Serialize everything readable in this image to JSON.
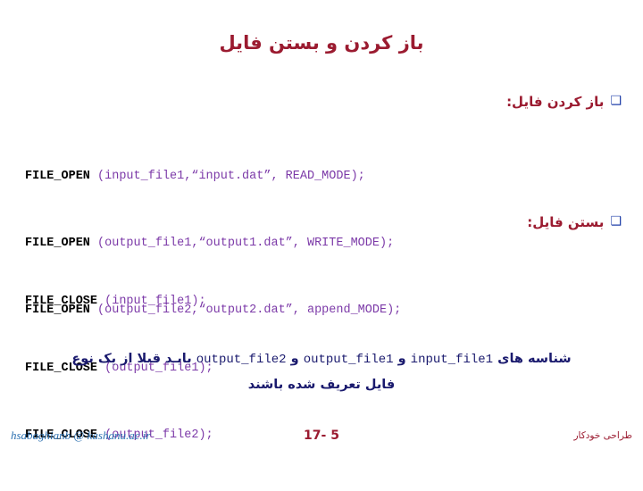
{
  "slide": {
    "title": "باز کردن و بستن فایل",
    "sections": [
      {
        "heading": "باز کردن فایل:",
        "marker": "❑",
        "lines": [
          {
            "fn": "FILE_OPEN",
            "args": "(input_file1,“input.dat”, READ_MODE);"
          },
          {
            "fn": "FILE_OPEN",
            "args": "(output_file1,“output1.dat”, WRITE_MODE);"
          },
          {
            "fn": "FILE_OPEN",
            "args": "(output_file2,“output2.dat”, append_MODE);"
          }
        ]
      },
      {
        "heading": "بستن فایل:",
        "marker": "❑",
        "lines": [
          {
            "fn": "FILE_CLOSE",
            "args": "(input_file1);"
          },
          {
            "fn": "FILE_CLOSE",
            "args": "(output_file1);"
          },
          {
            "fn": "FILE_CLOSE",
            "args": "(output_file2);"
          }
        ]
      }
    ],
    "note": {
      "line1_a": "شناسه های",
      "id1": "input_file1",
      "conj1": "و",
      "id2": "output_file1",
      "conj2": "و",
      "id3": "output_file2",
      "line1_b": "بایـد قبلا از یک نوع",
      "line2": "فایل تعریف شده باشند"
    },
    "footer": {
      "email": "hsabaghianb @ kashanu.ac.ir",
      "page": "17- 5",
      "right": "طراحی خودکار"
    }
  }
}
